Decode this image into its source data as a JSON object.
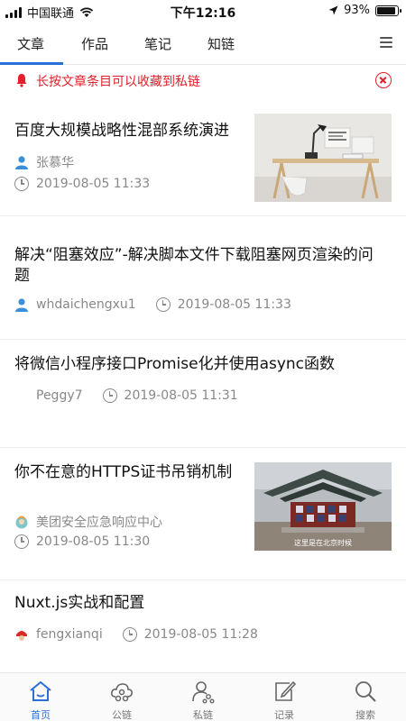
{
  "status_bar": {
    "carrier": "中国联通",
    "time": "下午12:16",
    "battery": "93%",
    "battery_level": 0.93,
    "icons": [
      "signal-icon",
      "wifi-icon",
      "location-icon",
      "battery-icon"
    ]
  },
  "tabs": [
    {
      "label": "文章",
      "active": true
    },
    {
      "label": "作品"
    },
    {
      "label": "笔记"
    },
    {
      "label": "知链"
    }
  ],
  "notice": {
    "text": "长按文章条目可以收藏到私链",
    "color": "#e0202a"
  },
  "articles": [
    {
      "title": "百度大规模战略性混部系统演进",
      "author": "张慕华",
      "time": "2019-08-05 11:33",
      "has_image": true,
      "image": "desk-photo"
    },
    {
      "title": "解决“阻塞效应”-解决脚本文件下载阻塞网页渲染的问题",
      "author": "whdaichengxu1",
      "time": "2019-08-05 11:33",
      "has_image": false
    },
    {
      "title": "将微信小程序接口Promise化并使用async函数",
      "author": "Peggy7",
      "time": "2019-08-05 11:31",
      "has_image": false
    },
    {
      "title": "你不在意的HTTPS证书吊销机制",
      "author": "美团安全应急响应中心",
      "time": "2019-08-05 11:30",
      "has_image": true,
      "image": "pavilion-photo",
      "image_caption": "这里是在北京时候"
    },
    {
      "title": "Nuxt.js实战和配置",
      "author": "fengxianqi",
      "time": "2019-08-05 11:28",
      "has_image": false
    }
  ],
  "bottom_nav": [
    {
      "label": "首页",
      "icon": "home-icon",
      "active": true
    },
    {
      "label": "公链",
      "icon": "cloud-link-icon"
    },
    {
      "label": "私链",
      "icon": "private-link-icon"
    },
    {
      "label": "记录",
      "icon": "edit-icon"
    },
    {
      "label": "搜索",
      "icon": "search-icon"
    }
  ],
  "colors": {
    "accent": "#2a6fd6",
    "notice": "#e0202a",
    "meta": "#888888"
  }
}
